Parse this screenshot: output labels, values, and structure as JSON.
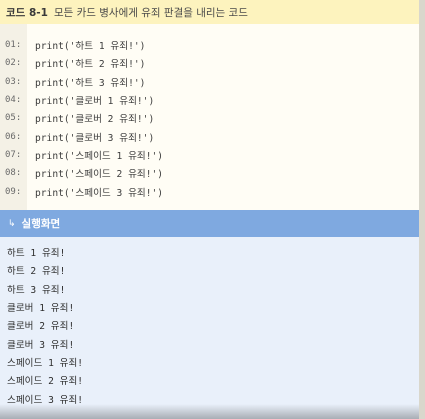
{
  "code_block": {
    "number": "코드 8-1",
    "title": "모든 카드 병사에게 유죄 판결을 내리는 코드",
    "lines": [
      {
        "no": "01:",
        "code": "print('하트 1 유죄!')"
      },
      {
        "no": "02:",
        "code": "print('하트 2 유죄!')"
      },
      {
        "no": "03:",
        "code": "print('하트 3 유죄!')"
      },
      {
        "no": "04:",
        "code": "print('클로버 1 유죄!')"
      },
      {
        "no": "05:",
        "code": "print('클로버 2 유죄!')"
      },
      {
        "no": "06:",
        "code": "print('클로버 3 유죄!')"
      },
      {
        "no": "07:",
        "code": "print('스페이드 1 유죄!')"
      },
      {
        "no": "08:",
        "code": "print('스페이드 2 유죄!')"
      },
      {
        "no": "09:",
        "code": "print('스페이드 3 유죄!')"
      }
    ]
  },
  "result_block": {
    "arrow_glyph": "↳",
    "title": "실행화면",
    "lines": [
      "하트 1 유죄!",
      "하트 2 유죄!",
      "하트 3 유죄!",
      "클로버 1 유죄!",
      "클로버 2 유죄!",
      "클로버 3 유죄!",
      "스페이드 1 유죄!",
      "스페이드 2 유죄!",
      "스페이드 3 유죄!"
    ]
  },
  "colors": {
    "code_header_bg": "#fdf3be",
    "code_bg": "#fffdf5",
    "result_header_bg": "#7fa9e0",
    "result_bg": "#e9f0fa"
  }
}
